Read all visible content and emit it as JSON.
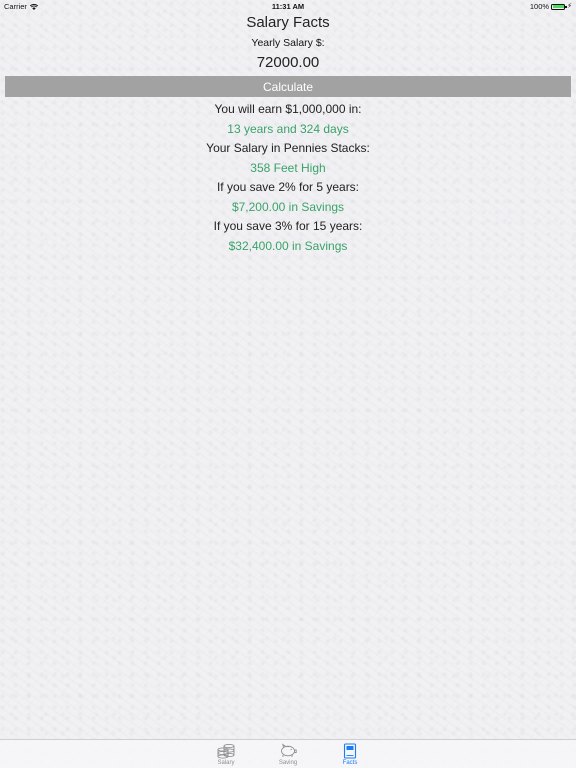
{
  "status_bar": {
    "carrier": "Carrier",
    "time": "11:31 AM",
    "battery": "100%"
  },
  "header": {
    "title": "Salary Facts",
    "salary_label": "Yearly Salary $:",
    "salary_value": "72000.00"
  },
  "actions": {
    "calculate_label": "Calculate"
  },
  "facts": {
    "million_label": "You will earn $1,000,000 in:",
    "million_value": "13 years and 324 days",
    "pennies_label": "Your Salary in Pennies Stacks:",
    "pennies_value": "358 Feet High",
    "save2_label": "If you save 2% for 5 years:",
    "save2_value": "$7,200.00 in Savings",
    "save3_label": "If you save 3% for 15 years:",
    "save3_value": "$32,400.00 in Savings"
  },
  "tabs": [
    {
      "label": "Salary",
      "icon": "coins-stack-icon"
    },
    {
      "label": "Saving",
      "icon": "piggy-bank-icon"
    },
    {
      "label": "Facts",
      "icon": "book-icon"
    }
  ],
  "colors": {
    "accent": "#1a7cf5",
    "answer_green": "#3aa26a",
    "button_gray": "#a2a2a2"
  }
}
